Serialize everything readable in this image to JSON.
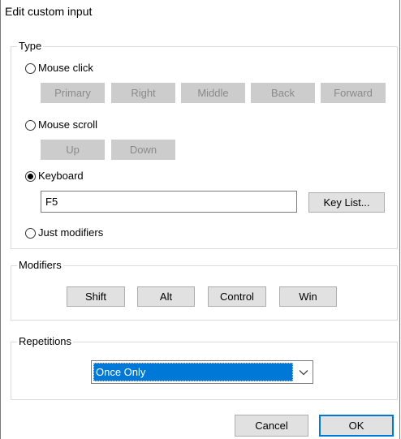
{
  "window": {
    "title": "Edit custom input"
  },
  "type_group": {
    "legend": "Type",
    "mouse_click": {
      "label": "Mouse click",
      "buttons": [
        "Primary",
        "Right",
        "Middle",
        "Back",
        "Forward"
      ]
    },
    "mouse_scroll": {
      "label": "Mouse scroll",
      "buttons": [
        "Up",
        "Down"
      ]
    },
    "keyboard": {
      "label": "Keyboard",
      "key_value": "F5",
      "key_list_label": "Key List..."
    },
    "just_modifiers": {
      "label": "Just modifiers"
    },
    "selected": "keyboard"
  },
  "modifiers_group": {
    "legend": "Modifiers",
    "buttons": [
      "Shift",
      "Alt",
      "Control",
      "Win"
    ]
  },
  "repetitions_group": {
    "legend": "Repetitions",
    "selected": "Once Only"
  },
  "footer": {
    "cancel_label": "Cancel",
    "ok_label": "OK"
  },
  "colors": {
    "accent": "#0078d7",
    "disabled_bg": "#cccccc",
    "disabled_text": "#8a8a8a",
    "button_bg": "#e1e1e1"
  },
  "icons": {
    "dropdown": "chevron-down-icon"
  }
}
